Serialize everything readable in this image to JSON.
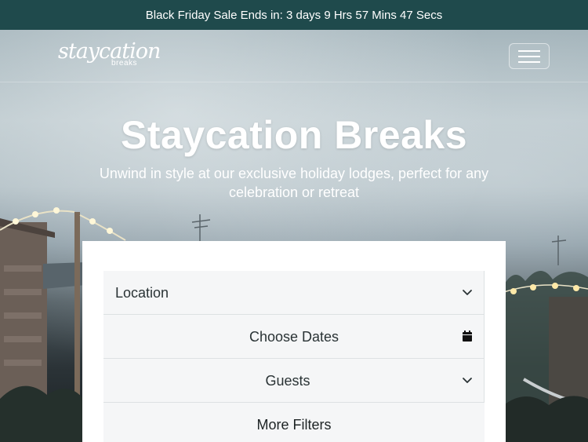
{
  "promo": {
    "text": "Black Friday Sale Ends in: 3 days 9 Hrs 57 Mins 47 Secs"
  },
  "brand": {
    "logo_script": "staycation",
    "logo_sub": "breaks"
  },
  "nav": {
    "menu_icon": "hamburger-menu-icon"
  },
  "hero": {
    "title": "Staycation Breaks",
    "subtitle": "Unwind in style at our exclusive holiday lodges, perfect for any celebration or retreat"
  },
  "search": {
    "location_label": "Location",
    "location_icon": "chevron-down-icon",
    "dates_label": "Choose Dates",
    "dates_icon": "calendar-icon",
    "guests_label": "Guests",
    "guests_icon": "chevron-down-icon",
    "more_filters_label": "More Filters"
  },
  "colors": {
    "brand_teal": "#1f4a4c",
    "panel_bg": "#ffffff",
    "field_bg": "#f5f6f7"
  }
}
